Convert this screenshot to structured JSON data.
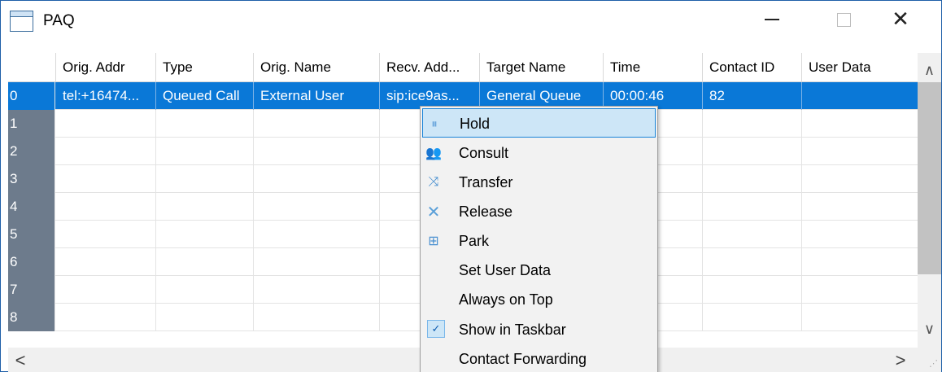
{
  "window": {
    "title": "PAQ",
    "icon": "window-app-icon",
    "controls": {
      "minimize": "minimize-icon",
      "maximize": "maximize-icon",
      "close": "✕"
    }
  },
  "table": {
    "columns": [
      "",
      "Orig. Addr",
      "Type",
      "Orig. Name",
      "Recv. Add...",
      "Target Name",
      "Time",
      "Contact ID",
      "User Data"
    ],
    "rows": [
      {
        "index": "0",
        "cells": [
          "tel:+16474...",
          "Queued Call",
          "External User",
          "sip:ice9as...",
          "General Queue",
          "00:00:46",
          "82",
          ""
        ]
      },
      {
        "index": "1",
        "cells": [
          "",
          "",
          "",
          "",
          "",
          "",
          "",
          ""
        ]
      },
      {
        "index": "2",
        "cells": [
          "",
          "",
          "",
          "",
          "",
          "",
          "",
          ""
        ]
      },
      {
        "index": "3",
        "cells": [
          "",
          "",
          "",
          "",
          "",
          "",
          "",
          ""
        ]
      },
      {
        "index": "4",
        "cells": [
          "",
          "",
          "",
          "",
          "",
          "",
          "",
          ""
        ]
      },
      {
        "index": "5",
        "cells": [
          "",
          "",
          "",
          "",
          "",
          "",
          "",
          ""
        ]
      },
      {
        "index": "6",
        "cells": [
          "",
          "",
          "",
          "",
          "",
          "",
          "",
          ""
        ]
      },
      {
        "index": "7",
        "cells": [
          "",
          "",
          "",
          "",
          "",
          "",
          "",
          ""
        ]
      },
      {
        "index": "8",
        "cells": [
          "",
          "",
          "",
          "",
          "",
          "",
          "",
          ""
        ]
      }
    ],
    "selected_row": "0"
  },
  "scrollbars": {
    "up": "∧",
    "down": "∨",
    "left": "<",
    "right": ">"
  },
  "context_menu": {
    "items": [
      {
        "label": "Hold",
        "icon": "hold-icon",
        "highlighted": true
      },
      {
        "label": "Consult",
        "icon": "consult-icon"
      },
      {
        "label": "Transfer",
        "icon": "transfer-icon"
      },
      {
        "label": "Release",
        "icon": "release-icon"
      },
      {
        "label": "Park",
        "icon": "park-icon"
      },
      {
        "label": "Set User Data",
        "icon": ""
      },
      {
        "label": "Always on Top",
        "icon": ""
      },
      {
        "label": "Show in Taskbar",
        "icon": "checkmark-icon",
        "checked": true
      },
      {
        "label": "Contact Forwarding",
        "icon": ""
      }
    ]
  },
  "colors": {
    "selection": "#0a78d7",
    "row_header": "#6d7b8c",
    "menu_highlight": "#cde6f7",
    "menu_highlight_border": "#1a84d8"
  }
}
